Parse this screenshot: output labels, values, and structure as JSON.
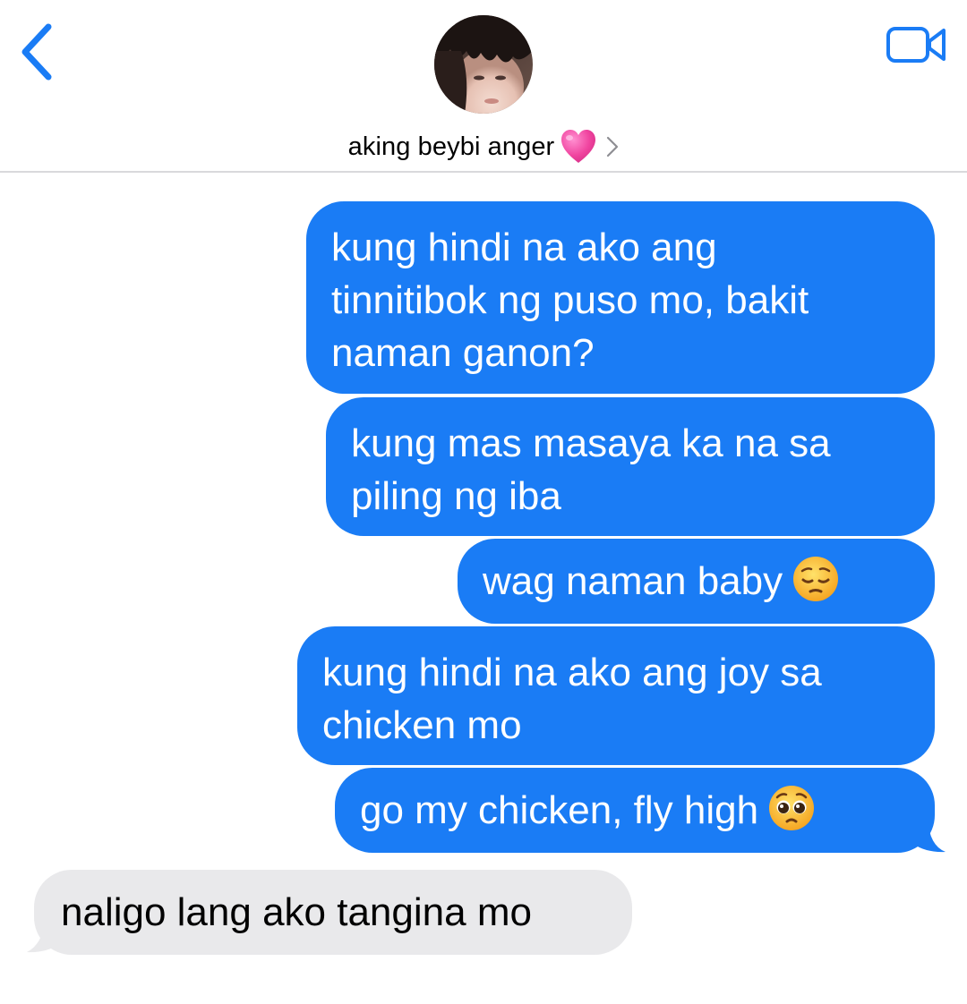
{
  "header": {
    "contact_name": "aking beybi anger",
    "name_icon": "pink-heart-icon",
    "back_icon": "chevron-left-icon",
    "video_icon": "video-camera-icon",
    "accent_color": "#1a7cf5"
  },
  "messages": [
    {
      "direction": "sent",
      "text": "kung hindi na ako ang\ntinnitibok ng puso mo, bakit\nnaman ganon?"
    },
    {
      "direction": "sent",
      "text": "kung mas masaya ka na sa\npiling ng iba"
    },
    {
      "direction": "sent",
      "text": "wag naman baby",
      "emoji": "pensive-face-emoji"
    },
    {
      "direction": "sent",
      "text": "kung hindi na ako ang joy sa\nchicken mo"
    },
    {
      "direction": "sent",
      "text": "go my chicken, fly high",
      "emoji": "pleading-face-emoji"
    },
    {
      "direction": "received",
      "text": "naligo lang ako tangina mo"
    }
  ],
  "colors": {
    "sent_bubble": "#1a7cf5",
    "received_bubble": "#e9e9eb"
  }
}
